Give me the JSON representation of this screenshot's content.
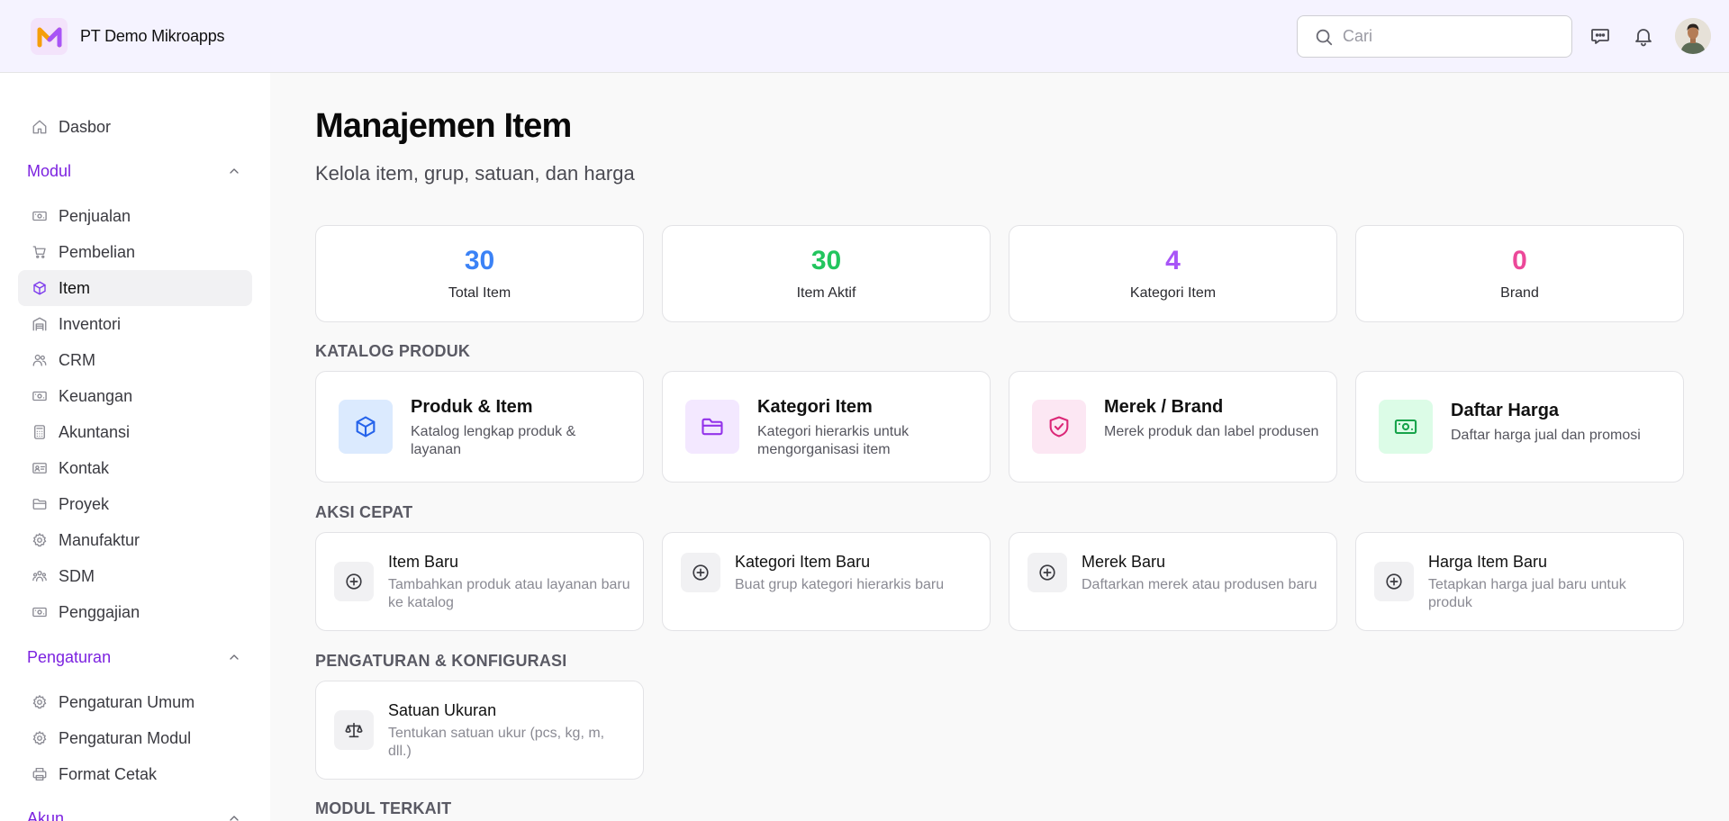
{
  "header": {
    "brand_name": "PT Demo Mikroapps",
    "search_placeholder": "Cari"
  },
  "sidebar": {
    "dashboard": "Dasbor",
    "sections": [
      {
        "label": "Modul"
      },
      {
        "label": "Pengaturan"
      },
      {
        "label": "Akun"
      }
    ],
    "modules": [
      {
        "label": "Penjualan",
        "icon": "banknote-icon"
      },
      {
        "label": "Pembelian",
        "icon": "cart-icon"
      },
      {
        "label": "Item",
        "icon": "box-icon",
        "active": true
      },
      {
        "label": "Inventori",
        "icon": "warehouse-icon"
      },
      {
        "label": "CRM",
        "icon": "users-icon"
      },
      {
        "label": "Keuangan",
        "icon": "banknote-icon"
      },
      {
        "label": "Akuntansi",
        "icon": "calculator-icon"
      },
      {
        "label": "Kontak",
        "icon": "contact-card-icon"
      },
      {
        "label": "Proyek",
        "icon": "folder-icon"
      },
      {
        "label": "Manufaktur",
        "icon": "gear-icon"
      },
      {
        "label": "SDM",
        "icon": "team-icon"
      },
      {
        "label": "Penggajian",
        "icon": "banknote-icon"
      }
    ],
    "settings": [
      {
        "label": "Pengaturan Umum",
        "icon": "gear-icon"
      },
      {
        "label": "Pengaturan Modul",
        "icon": "gear-icon"
      },
      {
        "label": "Format Cetak",
        "icon": "printer-icon"
      }
    ]
  },
  "main": {
    "title": "Manajemen Item",
    "subtitle": "Kelola item, grup, satuan, dan harga",
    "stats": [
      {
        "value": "30",
        "label": "Total Item",
        "color": "#3b82f6"
      },
      {
        "value": "30",
        "label": "Item Aktif",
        "color": "#22c55e"
      },
      {
        "value": "4",
        "label": "Kategori Item",
        "color": "#a855f7"
      },
      {
        "value": "0",
        "label": "Brand",
        "color": "#ec4899"
      }
    ],
    "catalog_title": "KATALOG PRODUK",
    "catalog": [
      {
        "title": "Produk & Item",
        "desc": "Katalog lengkap produk & layanan",
        "icon": "box-icon",
        "bg": "#dbeafe",
        "fg": "#2563eb"
      },
      {
        "title": "Kategori Item",
        "desc": "Kategori hierarkis untuk mengorganisasi item",
        "icon": "folder-icon",
        "bg": "#f3e8ff",
        "fg": "#9333ea"
      },
      {
        "title": "Merek / Brand",
        "desc": "Merek produk dan label produsen",
        "icon": "shield-check-icon",
        "bg": "#fce7f3",
        "fg": "#db2777"
      },
      {
        "title": "Daftar Harga",
        "desc": "Daftar harga jual dan promosi",
        "icon": "banknote-icon",
        "bg": "#dcfce7",
        "fg": "#16a34a"
      }
    ],
    "quick_title": "AKSI CEPAT",
    "quick": [
      {
        "title": "Item Baru",
        "desc": "Tambahkan produk atau layanan baru ke katalog"
      },
      {
        "title": "Kategori Item Baru",
        "desc": "Buat grup kategori hierarkis baru"
      },
      {
        "title": "Merek Baru",
        "desc": "Daftarkan merek atau produsen baru"
      },
      {
        "title": "Harga Item Baru",
        "desc": "Tetapkan harga jual baru untuk produk"
      }
    ],
    "config_title": "PENGATURAN & KONFIGURASI",
    "config": [
      {
        "title": "Satuan Ukuran",
        "desc": "Tentukan satuan ukur (pcs, kg, m, dll.)"
      }
    ],
    "related_title": "MODUL TERKAIT"
  }
}
